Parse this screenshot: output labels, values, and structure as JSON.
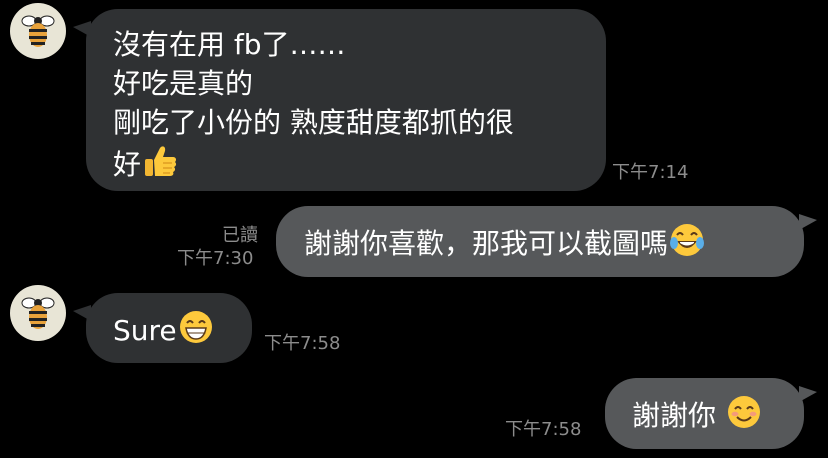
{
  "messages": [
    {
      "direction": "incoming",
      "lines": [
        "沒有在用 fb了……",
        "好吃是真的",
        "剛吃了小份的 熟度甜度都抓的很",
        "好"
      ],
      "emoji": "thumbs-up",
      "time": "下午7:14"
    },
    {
      "direction": "outgoing",
      "text": "謝謝你喜歡，那我可以截圖嗎",
      "emoji": "tears-of-joy",
      "read": "已讀",
      "time": "下午7:30"
    },
    {
      "direction": "incoming",
      "text": "Sure",
      "emoji": "grinning",
      "time": "下午7:58"
    },
    {
      "direction": "outgoing",
      "text": "謝謝你",
      "emoji": "smiling",
      "time": "下午7:58"
    }
  ],
  "colors": {
    "background": "#000000",
    "incoming_bubble": "#2f3133",
    "outgoing_bubble": "#56585a",
    "meta_text": "#8c8c8c"
  }
}
